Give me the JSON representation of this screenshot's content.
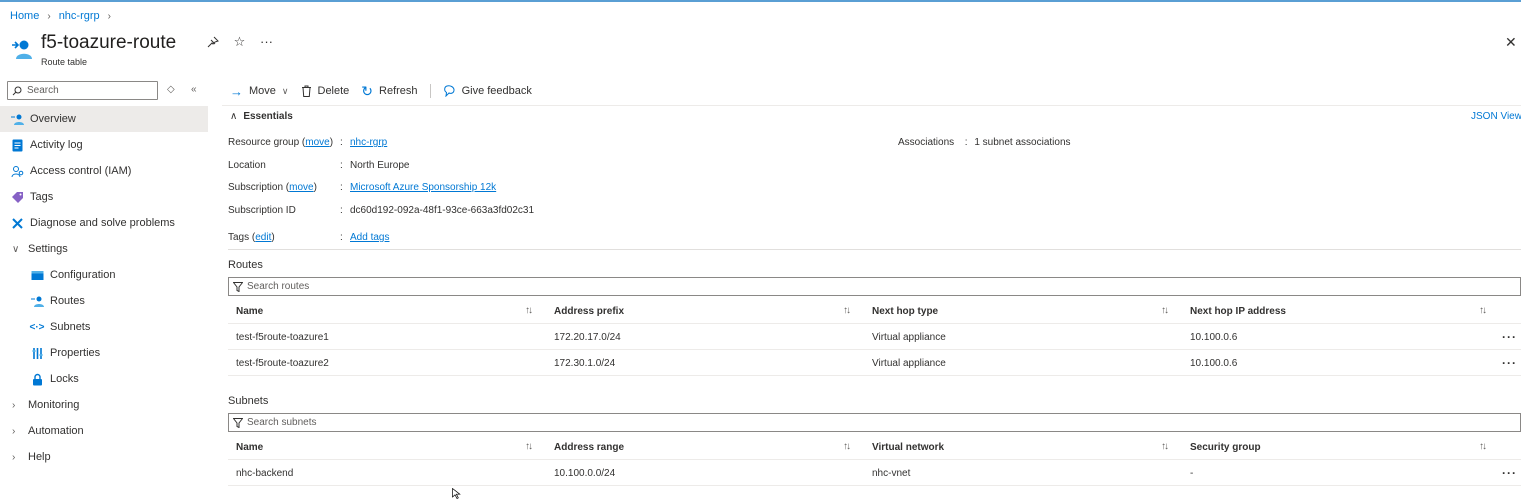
{
  "breadcrumb": {
    "home": "Home",
    "group": "nhc-rgrp"
  },
  "header": {
    "title": "f5-toazure-route",
    "subtitle": "Route table"
  },
  "sidebar": {
    "search_placeholder": "Search",
    "items": [
      {
        "label": "Overview",
        "icon": "route-table-icon"
      },
      {
        "label": "Activity log",
        "icon": "activity-log-icon"
      },
      {
        "label": "Access control (IAM)",
        "icon": "iam-icon"
      },
      {
        "label": "Tags",
        "icon": "tag-icon"
      },
      {
        "label": "Diagnose and solve problems",
        "icon": "wrench-icon"
      },
      {
        "label": "Settings",
        "icon": "chevron-down-icon"
      },
      {
        "label": "Configuration",
        "icon": "configuration-icon"
      },
      {
        "label": "Routes",
        "icon": "routes-icon"
      },
      {
        "label": "Subnets",
        "icon": "subnets-icon"
      },
      {
        "label": "Properties",
        "icon": "properties-icon"
      },
      {
        "label": "Locks",
        "icon": "lock-icon"
      },
      {
        "label": "Monitoring",
        "icon": "chevron-right-icon"
      },
      {
        "label": "Automation",
        "icon": "chevron-right-icon"
      },
      {
        "label": "Help",
        "icon": "chevron-right-icon"
      }
    ]
  },
  "toolbar": {
    "move": "Move",
    "delete": "Delete",
    "refresh": "Refresh",
    "feedback": "Give feedback"
  },
  "essentials": {
    "title": "Essentials",
    "json_view": "JSON View",
    "resource_group_label": "Resource group",
    "move_link": "move",
    "resource_group_value": "nhc-rgrp",
    "location_label": "Location",
    "location_value": "North Europe",
    "subscription_label": "Subscription",
    "subscription_value": "Microsoft Azure Sponsorship 12k",
    "subscription_id_label": "Subscription ID",
    "subscription_id_value": "dc60d192-092a-48f1-93ce-663a3fd02c31",
    "tags_label": "Tags",
    "edit_link": "edit",
    "tags_value": "Add tags",
    "associations_label": "Associations",
    "associations_value": "1 subnet associations"
  },
  "routes": {
    "title": "Routes",
    "search_placeholder": "Search routes",
    "columns": [
      "Name",
      "Address prefix",
      "Next hop type",
      "Next hop IP address"
    ],
    "rows": [
      [
        "test-f5route-toazure1",
        "172.20.17.0/24",
        "Virtual appliance",
        "10.100.0.6"
      ],
      [
        "test-f5route-toazure2",
        "172.30.1.0/24",
        "Virtual appliance",
        "10.100.0.6"
      ]
    ]
  },
  "subnets": {
    "title": "Subnets",
    "search_placeholder": "Search subnets",
    "columns": [
      "Name",
      "Address range",
      "Virtual network",
      "Security group"
    ],
    "rows": [
      [
        "nhc-backend",
        "10.100.0.0/24",
        "nhc-vnet",
        "-"
      ]
    ]
  },
  "colors": {
    "accent": "#0078d4",
    "active_bg": "#edebe9",
    "text": "#323130"
  }
}
